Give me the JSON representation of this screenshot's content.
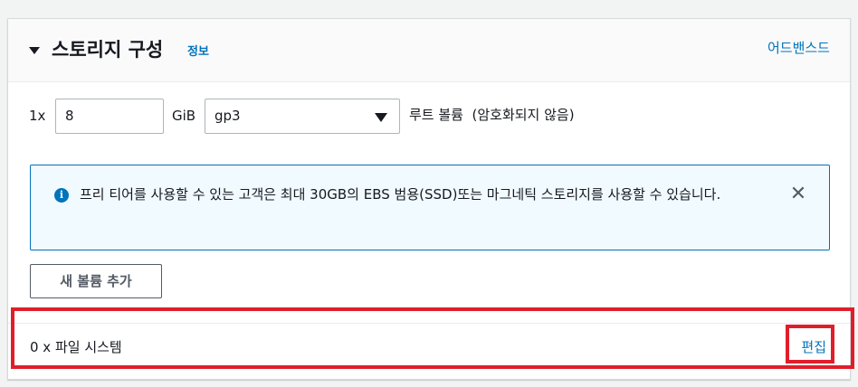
{
  "header": {
    "title": "스토리지 구성",
    "info_label": "정보",
    "advanced_label": "어드밴스드"
  },
  "volume_row": {
    "count_label": "1x",
    "size_value": "8",
    "unit_label": "GiB",
    "volume_type": "gp3",
    "description": "루트 볼륨  (암호화되지 않음)"
  },
  "alert": {
    "icon": "info-icon",
    "text": "프리 티어를 사용할 수 있는 고객은 최대 30GB의 EBS 범용(SSD)또는 마그네틱 스토리지를 사용할 수 있습니다.",
    "close_icon": "close-icon"
  },
  "add_volume_label": "새 볼륨 추가",
  "file_systems": {
    "label": "0 x 파일 시스템",
    "edit_label": "편집"
  },
  "colors": {
    "link": "#0073bb",
    "highlight": "#e01e2b",
    "alert_background": "#f1faff"
  }
}
